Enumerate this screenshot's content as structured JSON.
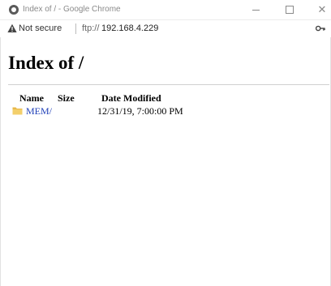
{
  "window": {
    "title": "Index of / - Google Chrome",
    "app_icon": "chrome-icon",
    "controls": {
      "minimize": "minimize-icon",
      "maximize": "maximize-icon",
      "close_glyph": "✕"
    }
  },
  "address_bar": {
    "security_icon": "warning-icon",
    "security_label": "Not secure",
    "url_scheme": "ftp://",
    "url_host": "192.168.4.229",
    "right_icon": "key-icon"
  },
  "page": {
    "heading": "Index of /",
    "columns": {
      "name": "Name",
      "size": "Size",
      "date": "Date Modified"
    },
    "entries": [
      {
        "icon": "folder-icon",
        "name": "MEM/",
        "size": "",
        "date": "12/31/19, 7:00:00 PM"
      }
    ]
  },
  "colors": {
    "link": "#2040b8",
    "folder": "#e8b84a"
  }
}
